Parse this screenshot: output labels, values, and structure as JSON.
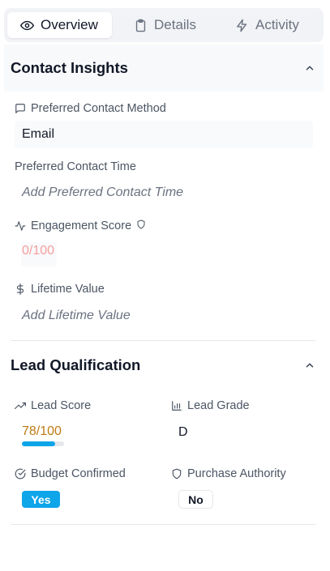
{
  "tabs": [
    {
      "label": "Overview",
      "icon": "eye-icon",
      "active": true
    },
    {
      "label": "Details",
      "icon": "clipboard-icon",
      "active": false
    },
    {
      "label": "Activity",
      "icon": "lightning-icon",
      "active": false
    }
  ],
  "contact_insights": {
    "title": "Contact Insights",
    "preferred_contact_method": {
      "label": "Preferred Contact Method",
      "value": "Email",
      "icon": "message-icon"
    },
    "preferred_contact_time": {
      "label": "Preferred Contact Time",
      "placeholder": "Add Preferred Contact Time"
    },
    "engagement_score": {
      "label": "Engagement Score",
      "value": "0/100",
      "icon": "activity-icon",
      "badge_icon": "shield-icon"
    },
    "lifetime_value": {
      "label": "Lifetime Value",
      "placeholder": "Add Lifetime Value",
      "icon": "dollar-icon"
    }
  },
  "lead_qualification": {
    "title": "Lead Qualification",
    "lead_score": {
      "label": "Lead Score",
      "value": "78/100",
      "progress": 0.78,
      "icon": "trending-up-icon"
    },
    "lead_grade": {
      "label": "Lead Grade",
      "value": "D",
      "icon": "bar-chart-icon"
    },
    "budget_confirmed": {
      "label": "Budget Confirmed",
      "value": "Yes",
      "icon": "check-circle-icon"
    },
    "purchase_authority": {
      "label": "Purchase Authority",
      "value": "No",
      "icon": "shield-icon"
    }
  },
  "colors": {
    "accent": "#0ea5e9",
    "score_orange": "#c07a12",
    "score_zero": "#f59e9e"
  }
}
